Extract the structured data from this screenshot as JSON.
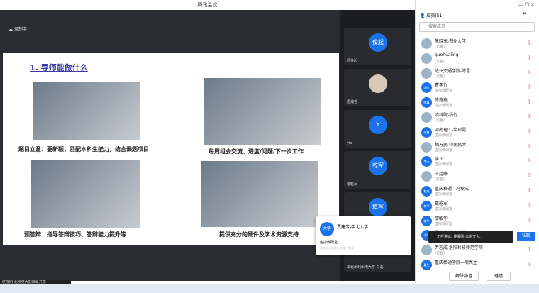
{
  "window": {
    "title": "腾讯会议",
    "recording": "录制中",
    "share_label": "侯湘刚-北京交大的屏幕共享"
  },
  "slide": {
    "title": "1. 导师能做什么",
    "captions": [
      "题目立意：要新颖，匹配本科生能力，结合课题项目",
      "每周组会交流、进度/问题/下一步工作",
      "预答辩：指导答辩技巧、答辩能力提升等",
      "提供充分的硬件及学术资源支持"
    ]
  },
  "videos": [
    {
      "avatar": "俊起",
      "name": "杨俊起"
    },
    {
      "avatar": "",
      "name": "屈瀚哲"
    },
    {
      "avatar": "Y",
      "name": "yfa"
    },
    {
      "avatar": "乾军",
      "name": "戴乾军"
    },
    {
      "avatar": "填写",
      "name": "华北水利水电大学 白磊"
    }
  ],
  "card": {
    "avatar": "大学",
    "name": "贾建芳-中北大学",
    "room": "虚拟教研室",
    "note": "该成员已使用企业用户登录"
  },
  "panel": {
    "title": "成员(51)",
    "search_placeholder": "搜索成员",
    "members": [
      {
        "a": "",
        "n": "朱晓东-郑州大学",
        "r": "(访客)"
      },
      {
        "a": "",
        "n": "guohualing",
        "r": "(访客)"
      },
      {
        "a": "",
        "n": "沧州交通学院-陈雷",
        "r": "(访客)"
      },
      {
        "a": "李竹",
        "n": "曹李竹",
        "r": "虚拟教研室"
      },
      {
        "a": "陈鑫",
        "n": "陈鑫鑫",
        "r": "虚拟教研室"
      },
      {
        "a": "",
        "n": "滇科院-杨竹",
        "r": "(访客)"
      },
      {
        "a": "琼霞",
        "n": "河南理工-余琼霞",
        "r": "虚拟教研室"
      },
      {
        "a": "",
        "n": "胡万民-中南民大",
        "r": "虚拟教研室"
      },
      {
        "a": "李正",
        "n": "李正",
        "r": "虚拟教研室"
      },
      {
        "a": "",
        "n": "王廷峰",
        "r": "(访客)"
      },
      {
        "a": "秋成",
        "n": "重庆移通—冯秋成",
        "r": "虚拟教研室"
      },
      {
        "a": "乾军",
        "n": "戴乾军",
        "r": "虚拟教研室"
      },
      {
        "a": "敏华",
        "n": "邵敏华",
        "r": "虚拟教研室"
      },
      {
        "a": "大学",
        "n": "贾建芳-中北大学",
        "r": "虚拟教研室"
      },
      {
        "a": "",
        "n": "尹志成 洛阳科技师范学院",
        "r": "(访客)"
      },
      {
        "a": "嘉生",
        "n": "重庆移通学院—周亮生",
        "r": ""
      }
    ],
    "speaking": "正在讲话: 侯湘刚-北京交大;",
    "private_chat": "私聊",
    "unmute_all": "解除静音",
    "invite": "邀请"
  }
}
